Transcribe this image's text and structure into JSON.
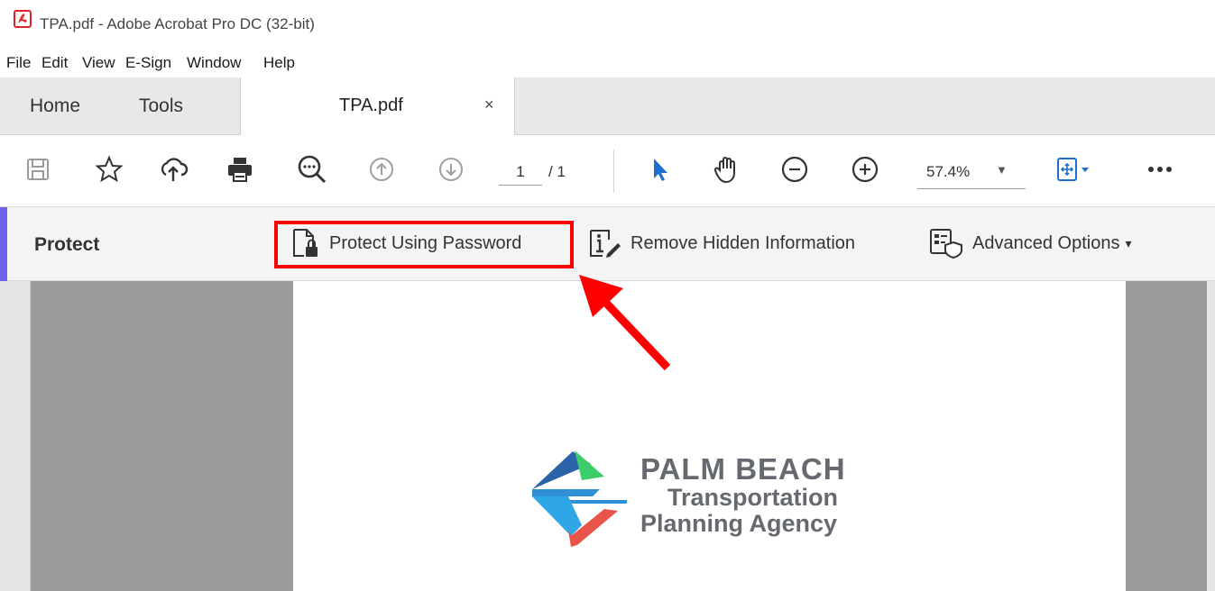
{
  "window": {
    "title": "TPA.pdf - Adobe Acrobat Pro DC (32-bit)"
  },
  "menu": [
    "File",
    "Edit",
    "View",
    "E-Sign",
    "Window",
    "Help"
  ],
  "tabs": {
    "home": "Home",
    "tools": "Tools",
    "document": "TPA.pdf",
    "close_icon": "×"
  },
  "toolbar": {
    "page_current": "1",
    "page_total": "/ 1",
    "zoom": "57.4%",
    "icons": [
      "save-icon",
      "star-icon",
      "cloud-upload-icon",
      "print-icon",
      "zoom-search-icon",
      "page-up-icon",
      "page-down-icon",
      "select-arrow-icon",
      "hand-icon",
      "zoom-out-icon",
      "zoom-in-icon",
      "fit-page-icon",
      "more-icon"
    ]
  },
  "protect_bar": {
    "title": "Protect",
    "buttons": {
      "password": "Protect Using Password",
      "remove_hidden": "Remove Hidden Information",
      "advanced": "Advanced Options"
    },
    "advanced_caret": "▾",
    "accent_color": "#6b63e8"
  },
  "annotation": {
    "highlight_color": "#ff0000"
  },
  "document": {
    "logo_line1": "PALM BEACH",
    "logo_line2": "Transportation",
    "logo_line3": "Planning Agency"
  }
}
